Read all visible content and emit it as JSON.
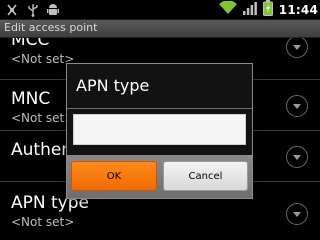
{
  "status_bar": {
    "time": "11:44",
    "icons": [
      "usb-debug-icon",
      "usb-icon",
      "android-icon",
      "wifi-icon",
      "signal-icon",
      "battery-charging-icon"
    ]
  },
  "title_bar": {
    "title": "Edit access point"
  },
  "preferences": [
    {
      "title": "MCC",
      "summary": "<Not set>"
    },
    {
      "title": "MNC",
      "summary": "<Not set>"
    },
    {
      "title": "Authentication type",
      "summary": ""
    },
    {
      "title": "APN type",
      "summary": "<Not set>"
    }
  ],
  "dialog": {
    "title": "APN type",
    "input_value": "",
    "ok_label": "OK",
    "cancel_label": "Cancel"
  },
  "colors": {
    "ok_button": "#f57a0b",
    "title_bar": "#4a4a4a",
    "wifi": "#7ec636"
  }
}
